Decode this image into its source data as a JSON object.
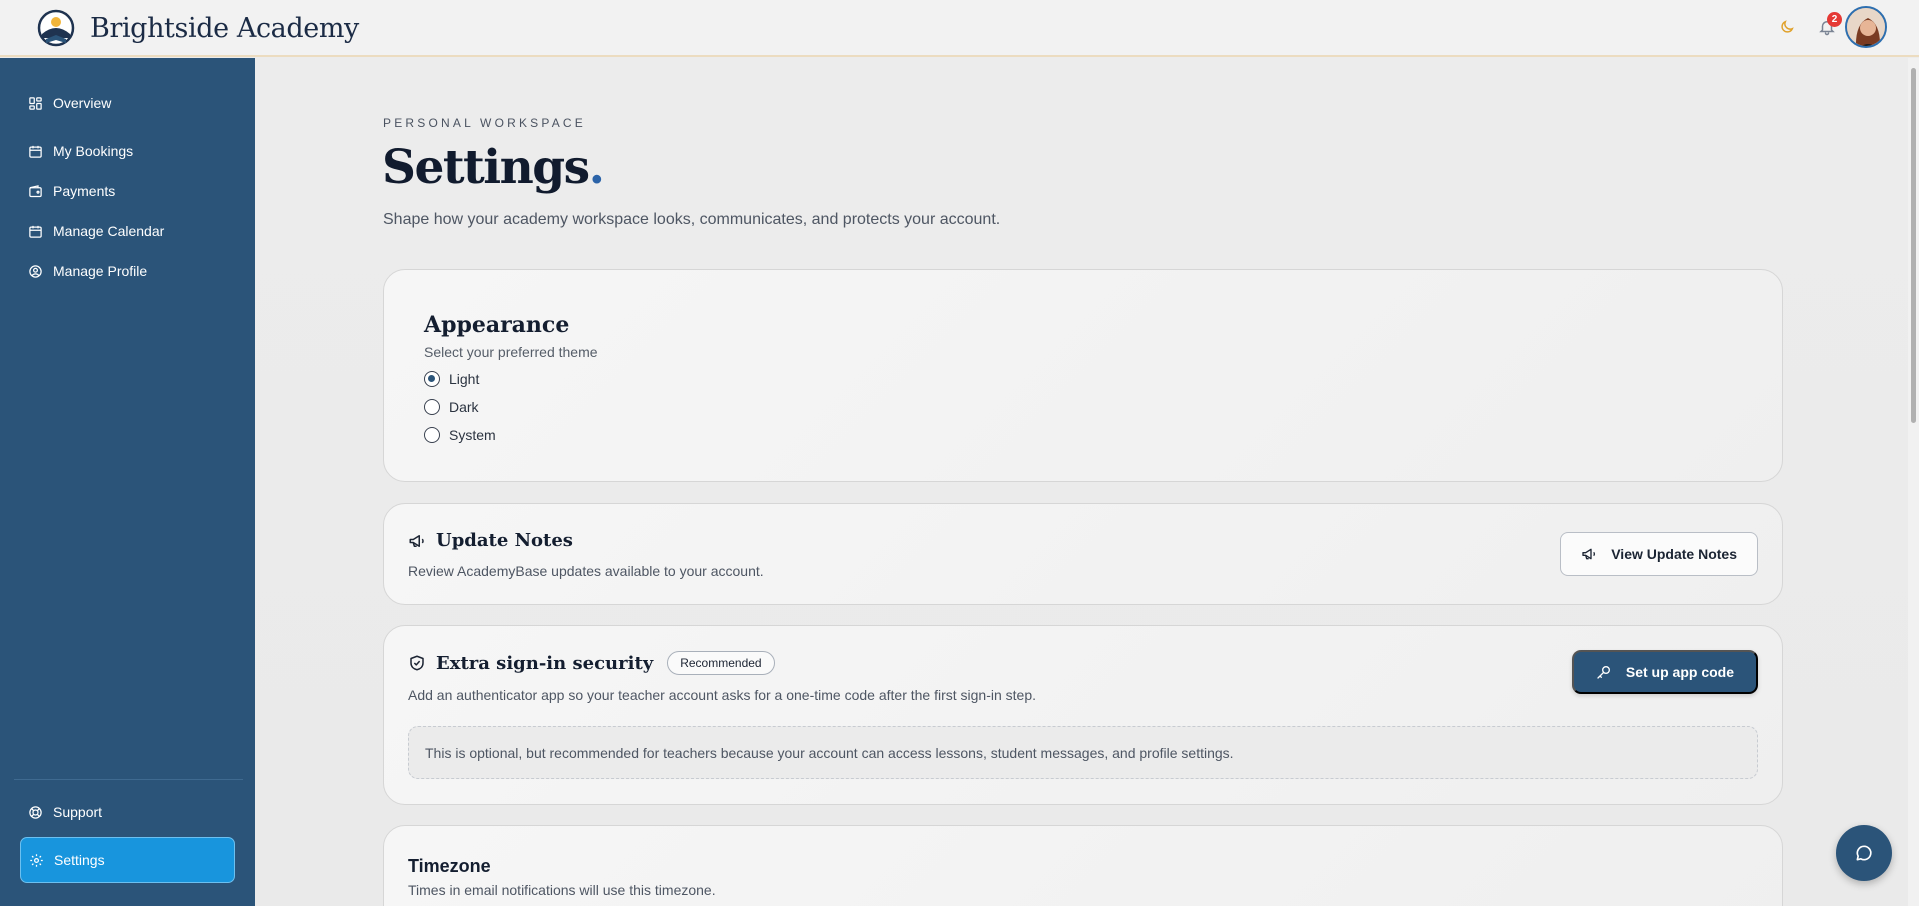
{
  "brand": {
    "name": "Brightside Academy"
  },
  "topbar": {
    "theme_icon": "moon-icon",
    "notification_icon": "bell-icon",
    "notification_count": "2",
    "avatar_alt": "User avatar"
  },
  "sidebar": {
    "items": [
      {
        "label": "Overview",
        "icon": "grid-icon"
      },
      {
        "label": "My Bookings",
        "icon": "calendar-icon"
      },
      {
        "label": "Payments",
        "icon": "wallet-icon"
      },
      {
        "label": "Manage Calendar",
        "icon": "calendar-icon"
      },
      {
        "label": "Manage Profile",
        "icon": "user-circle-icon"
      }
    ],
    "footer_items": [
      {
        "label": "Support",
        "icon": "lifebuoy-icon"
      },
      {
        "label": "Settings",
        "icon": "gear-icon",
        "active": true
      }
    ],
    "colors": {
      "background": "#2b5479",
      "active": "#1895dd"
    }
  },
  "header": {
    "eyebrow": "PERSONAL WORKSPACE",
    "title": "Settings",
    "title_dot": ".",
    "subtitle": "Shape how your academy workspace looks, communicates, and protects your account."
  },
  "appearance": {
    "title": "Appearance",
    "hint": "Select your preferred theme",
    "options": [
      {
        "label": "Light",
        "selected": true
      },
      {
        "label": "Dark",
        "selected": false
      },
      {
        "label": "System",
        "selected": false
      }
    ]
  },
  "updates": {
    "title": "Update Notes",
    "icon": "megaphone-icon",
    "description": "Review AcademyBase updates available to your account.",
    "button_label": "View Update Notes"
  },
  "security": {
    "title": "Extra sign-in security",
    "icon": "shield-check-icon",
    "badge": "Recommended",
    "description": "Add an authenticator app so your teacher account asks for a one-time code after the first sign-in step.",
    "button_label": "Set up app code",
    "button_icon": "key-icon",
    "note": "This is optional, but recommended for teachers because your account can access lessons, student messages, and profile settings."
  },
  "timezone": {
    "title": "Timezone",
    "description": "Times in email notifications will use this timezone."
  },
  "chat": {
    "icon": "chat-bubble-icon"
  },
  "colors": {
    "primary": "#2b5479",
    "accent": "#1895dd",
    "badge_red": "#e53935"
  }
}
